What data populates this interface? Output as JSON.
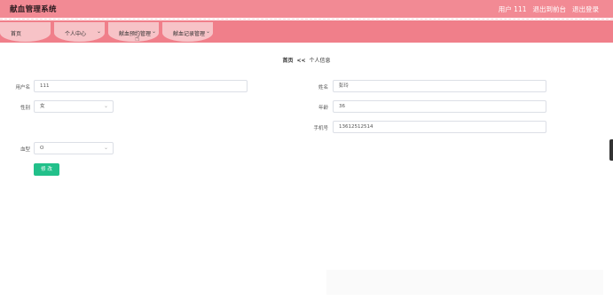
{
  "header": {
    "app_title": "献血管理系统",
    "user": "用户 111",
    "backend_link": "退出到前台",
    "logout_link": "退出登录"
  },
  "nav": {
    "tabs": [
      {
        "label": "首页",
        "has_dropdown": false
      },
      {
        "label": "个人中心",
        "has_dropdown": true
      },
      {
        "label": "献血预约管理",
        "has_dropdown": true
      },
      {
        "label": "献血记录管理",
        "has_dropdown": true
      }
    ]
  },
  "breadcrumb": {
    "home": "首页",
    "separator": "<<",
    "current": "个人信息"
  },
  "form": {
    "username": {
      "label": "用户名",
      "value": "111"
    },
    "name": {
      "label": "姓名",
      "value": "彭玲"
    },
    "gender": {
      "label": "性别",
      "value": "女"
    },
    "age": {
      "label": "年龄",
      "value": "36"
    },
    "phone": {
      "label": "手机号",
      "value": "13612512514"
    },
    "blood_type": {
      "label": "血型",
      "value": "O"
    },
    "submit_label": "修 改"
  },
  "icons": {
    "dropdown": "chevron-down-icon",
    "pointer": "hand-cursor-icon"
  },
  "colors": {
    "topbar": "#f28a94",
    "navbar": "#f07f8a",
    "tab": "#f7c3c7",
    "submit": "#22c08a"
  }
}
